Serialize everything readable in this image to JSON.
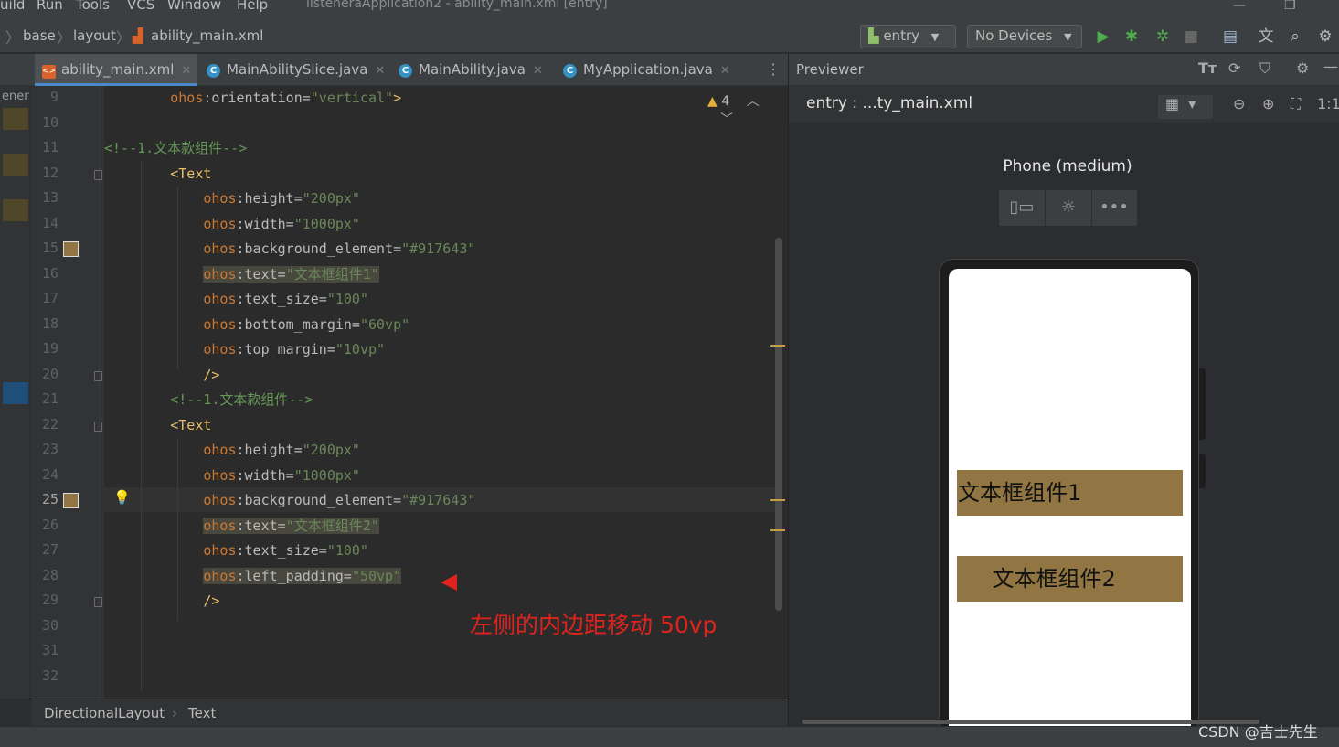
{
  "menubar": {
    "items": [
      "uild",
      "Run",
      "Tools",
      "VCS",
      "Window",
      "Help"
    ],
    "title": "listeneraApplication2 - ability_main.xml [entry]"
  },
  "navbar": {
    "crumbs": [
      "base",
      "layout",
      "ability_main.xml"
    ],
    "run_config": "entry",
    "device": "No Devices"
  },
  "tabs": [
    {
      "label": "ability_main.xml",
      "type": "xml",
      "active": true
    },
    {
      "label": "MainAbilitySlice.java",
      "type": "java",
      "active": false
    },
    {
      "label": "MainAbility.java",
      "type": "java",
      "active": false
    },
    {
      "label": "MyApplication.java",
      "type": "java",
      "active": false
    }
  ],
  "left_strip_text": "ener",
  "editor": {
    "warning_count": "4",
    "current_line": 25,
    "line_numbers": [
      "9",
      "10",
      "11",
      "12",
      "13",
      "14",
      "15",
      "16",
      "17",
      "18",
      "19",
      "20",
      "21",
      "22",
      "23",
      "24",
      "25",
      "26",
      "27",
      "28",
      "29",
      "30",
      "31",
      "32"
    ],
    "lines": [
      {
        "indent": "        ",
        "ns": "ohos",
        "attr": ":orientation=",
        "val": "\"vertical\"",
        "tail": ">",
        "kind": "attr"
      },
      {
        "kind": "empty"
      },
      {
        "indent": "",
        "text": "<!--1.文本款组件-->",
        "kind": "comment"
      },
      {
        "indent": "        ",
        "text": "<Text",
        "kind": "tag"
      },
      {
        "indent": "            ",
        "ns": "ohos",
        "attr": ":height=",
        "val": "\"200px\"",
        "kind": "attr"
      },
      {
        "indent": "            ",
        "ns": "ohos",
        "attr": ":width=",
        "val": "\"1000px\"",
        "kind": "attr"
      },
      {
        "indent": "            ",
        "ns": "ohos",
        "attr": ":background_element=",
        "val": "\"#917643\"",
        "kind": "attr"
      },
      {
        "indent": "            ",
        "ns": "ohos",
        "attr": ":text=",
        "val": "\"文本框组件1\"",
        "kind": "attr",
        "hl": true
      },
      {
        "indent": "            ",
        "ns": "ohos",
        "attr": ":text_size=",
        "val": "\"100\"",
        "kind": "attr"
      },
      {
        "indent": "            ",
        "ns": "ohos",
        "attr": ":bottom_margin=",
        "val": "\"60vp\"",
        "kind": "attr"
      },
      {
        "indent": "            ",
        "ns": "ohos",
        "attr": ":top_margin=",
        "val": "\"10vp\"",
        "kind": "attr"
      },
      {
        "indent": "            ",
        "text": "/>",
        "kind": "tag"
      },
      {
        "indent": "        ",
        "text": "<!--1.文本款组件-->",
        "kind": "comment"
      },
      {
        "indent": "        ",
        "text": "<Text",
        "kind": "tag"
      },
      {
        "indent": "            ",
        "ns": "ohos",
        "attr": ":height=",
        "val": "\"200px\"",
        "kind": "attr"
      },
      {
        "indent": "            ",
        "ns": "ohos",
        "attr": ":width=",
        "val": "\"1000px\"",
        "kind": "attr"
      },
      {
        "indent": "            ",
        "ns": "ohos",
        "attr": ":background_element=",
        "val": "\"#917643\"",
        "kind": "attr"
      },
      {
        "indent": "            ",
        "ns": "ohos",
        "attr": ":text=",
        "val": "\"文本框组件2\"",
        "kind": "attr",
        "hl": true
      },
      {
        "indent": "            ",
        "ns": "ohos",
        "attr": ":text_size=",
        "val": "\"100\"",
        "kind": "attr"
      },
      {
        "indent": "            ",
        "ns": "ohos",
        "attr": ":left_padding=",
        "val": "\"50vp\"",
        "kind": "attr",
        "hl": true
      },
      {
        "indent": "            ",
        "text": "/>",
        "kind": "tag"
      },
      {
        "kind": "empty"
      },
      {
        "kind": "empty"
      },
      {
        "kind": "empty"
      }
    ]
  },
  "breadcrumb": [
    "DirectionalLayout",
    "Text"
  ],
  "previewer": {
    "title": "Previewer",
    "entry": "entry : ...ty_main.xml",
    "device_label": "Phone (medium)",
    "components": [
      {
        "text": "文本框组件1",
        "left_padding_vp": 0
      },
      {
        "text": "文本框组件2",
        "left_padding_vp": 50
      }
    ]
  },
  "annotation": "左侧的内边距移动 50vp",
  "watermark": "CSDN @吉士先生",
  "colors": {
    "component_bg": "#917643",
    "annotation": "#e1231d",
    "keyword": "#cc7832",
    "tag": "#e8bf6a",
    "value": "#6a8759",
    "comment": "#629755"
  }
}
